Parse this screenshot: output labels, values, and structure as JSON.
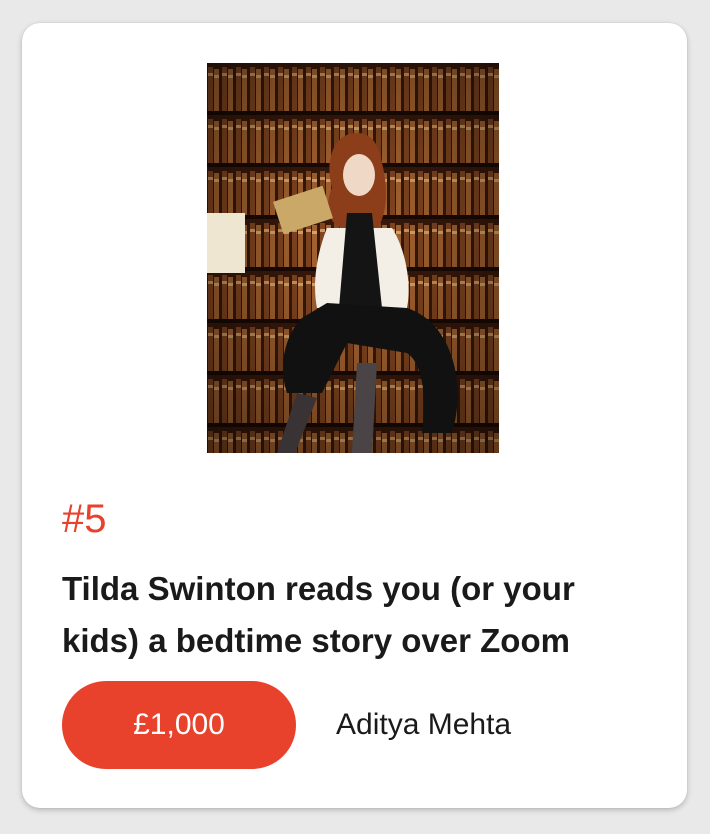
{
  "listing": {
    "image_icon": "portrait-photo",
    "rank": "#5",
    "title": "Tilda Swinton reads you (or your kids) a bedtime story over Zoom",
    "price": "£1,000",
    "seller": "Aditya Mehta"
  },
  "colors": {
    "accent": "#e8412c",
    "card_background": "#ffffff",
    "text": "#1a1a1a"
  }
}
